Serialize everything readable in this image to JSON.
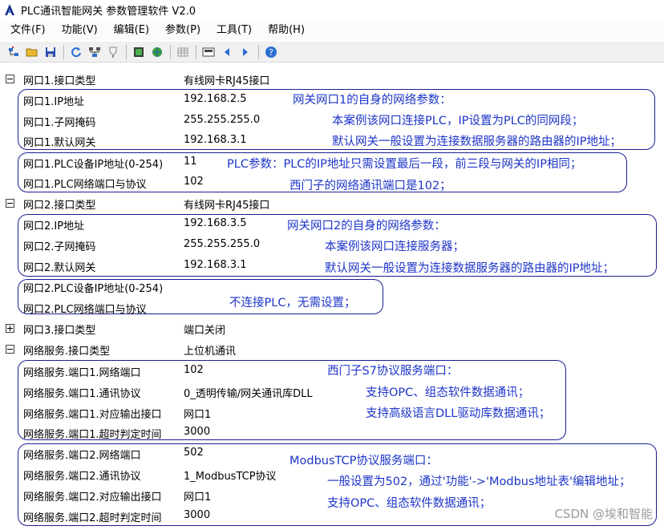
{
  "window": {
    "title": "PLC通讯智能网关 参数管理软件 V2.0"
  },
  "menu": [
    "文件(F)",
    "功能(V)",
    "编辑(E)",
    "参数(P)",
    "工具(T)",
    "帮助(H)"
  ],
  "toolbar_icons": [
    "connect-icon",
    "open-folder-icon",
    "save-icon",
    "refresh-icon",
    "network-icon",
    "plug-icon",
    "download-icon",
    "upload-globe-icon",
    "table-icon",
    "id-card-icon",
    "prev-arrow-icon",
    "next-arrow-icon",
    "help-icon"
  ],
  "tree": {
    "port1_type": {
      "name": "网口1.接口类型",
      "value": "有线网卡RJ45接口"
    },
    "port1_ip": {
      "name": "网口1.IP地址",
      "value": "192.168.2.5"
    },
    "port1_mask": {
      "name": "网口1.子网掩码",
      "value": "255.255.255.0"
    },
    "port1_gw": {
      "name": "网口1.默认网关",
      "value": "192.168.3.1"
    },
    "port1_plc_ip": {
      "name": "网口1.PLC设备IP地址(0-254)",
      "value": "11"
    },
    "port1_plc_port": {
      "name": "网口1.PLC网络端口与协议",
      "value": "102"
    },
    "port2_type": {
      "name": "网口2.接口类型",
      "value": "有线网卡RJ45接口"
    },
    "port2_ip": {
      "name": "网口2.IP地址",
      "value": "192.168.3.5"
    },
    "port2_mask": {
      "name": "网口2.子网掩码",
      "value": "255.255.255.0"
    },
    "port2_gw": {
      "name": "网口2.默认网关",
      "value": "192.168.3.1"
    },
    "port2_plc_ip": {
      "name": "网口2.PLC设备IP地址(0-254)",
      "value": ""
    },
    "port2_plc_port": {
      "name": "网口2.PLC网络端口与协议",
      "value": ""
    },
    "port3_type": {
      "name": "网口3.接口类型",
      "value": "端口关闭"
    },
    "svc_type": {
      "name": "网络服务.接口类型",
      "value": "上位机通讯"
    },
    "svc1_port": {
      "name": "网络服务.端口1.网络端口",
      "value": "102"
    },
    "svc1_proto": {
      "name": "网络服务.端口1.通讯协议",
      "value": "0_透明传输/网关通讯库DLL"
    },
    "svc1_out": {
      "name": "网络服务.端口1.对应输出接口",
      "value": "网口1"
    },
    "svc1_timeout": {
      "name": "网络服务.端口1.超时判定时间",
      "value": "3000"
    },
    "svc2_port": {
      "name": "网络服务.端口2.网络端口",
      "value": "502"
    },
    "svc2_proto": {
      "name": "网络服务.端口2.通讯协议",
      "value": "1_ModbusTCP协议"
    },
    "svc2_out": {
      "name": "网络服务.端口2.对应输出接口",
      "value": "网口1"
    },
    "svc2_timeout": {
      "name": "网络服务.端口2.超时判定时间",
      "value": "3000"
    }
  },
  "notes": {
    "n1": "网关网口1的自身的网络参数：",
    "n2": "本案例该网口连接PLC，IP设置为PLC的同网段；",
    "n3": "默认网关一般设置为连接数据服务器的路由器的IP地址；",
    "n4": "PLC参数：PLC的IP地址只需设置最后一段，前三段与网关的IP相同；",
    "n5": "西门子的网络通讯端口是102；",
    "n6": "网关网口2的自身的网络参数：",
    "n7": "本案例该网口连接服务器；",
    "n8": "默认网关一般设置为连接数据服务器的路由器的IP地址；",
    "n9": "不连接PLC，无需设置；",
    "n10": "西门子S7协议服务端口：",
    "n11": "支持OPC、组态软件数据通讯；",
    "n12": "支持高级语言DLL驱动库数据通讯；",
    "n13": "ModbusTCP协议服务端口：",
    "n14": "一般设置为502，通过'功能'->'Modbus地址表'编辑地址；",
    "n15": "支持OPC、组态软件数据通讯；"
  },
  "watermark": "CSDN @埃和智能",
  "colors": {
    "annotation": "#1d35c8",
    "box_border": "#1a1f8f"
  }
}
